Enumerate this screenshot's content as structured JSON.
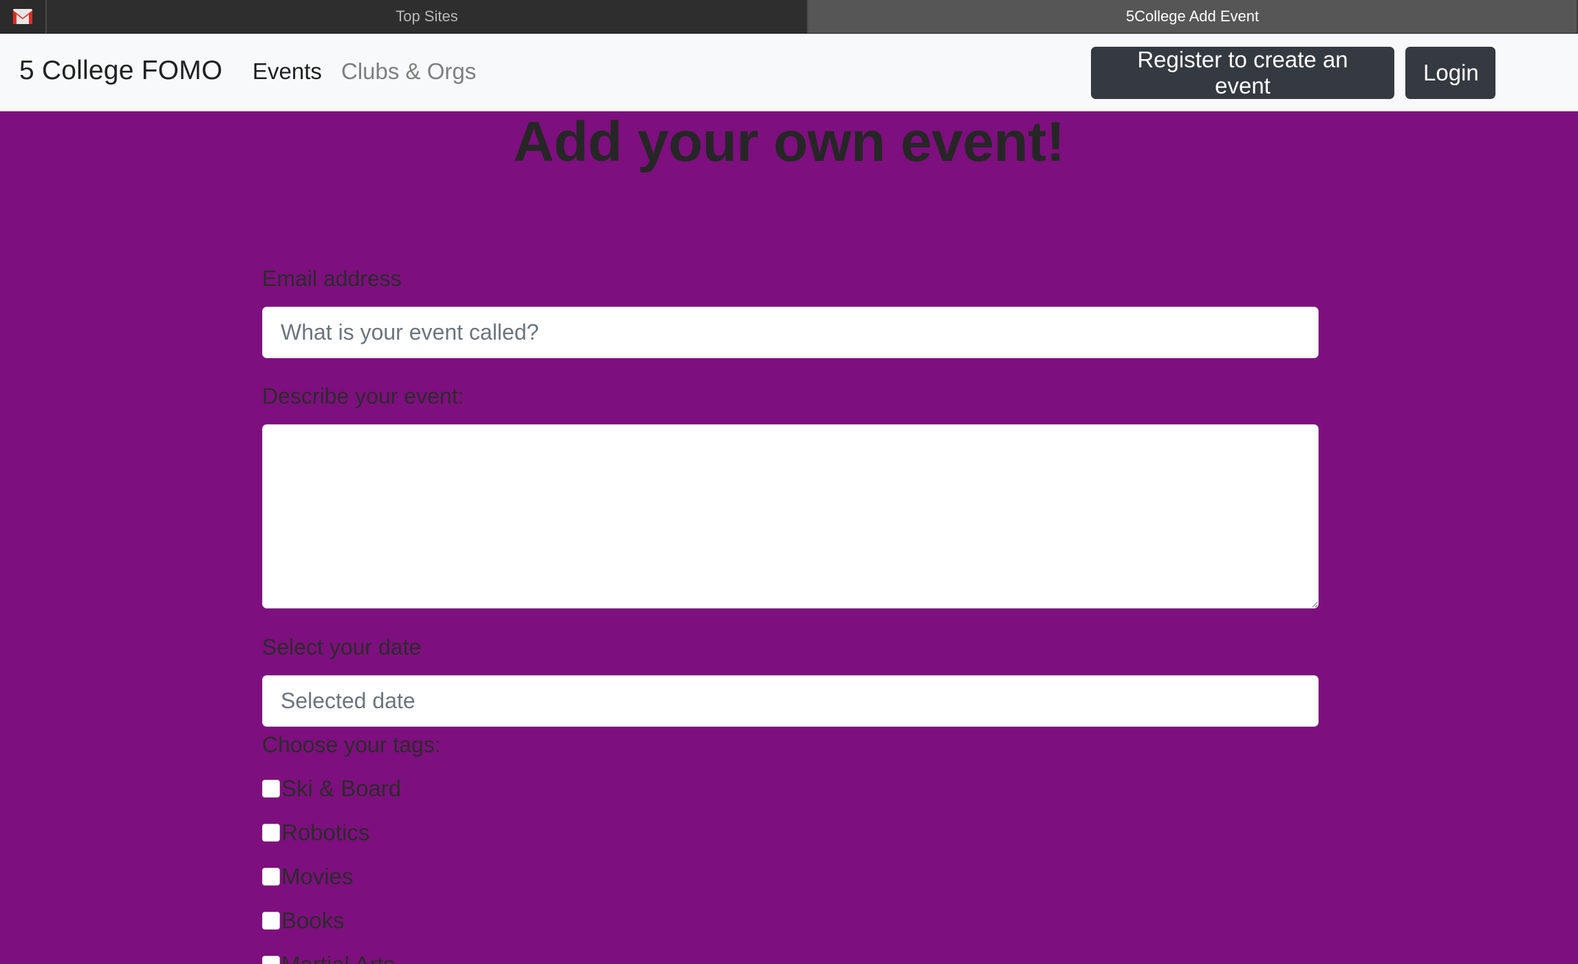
{
  "browser": {
    "pinned_tab_icon": "gmail-icon",
    "tabs": [
      {
        "label": "Top Sites",
        "active": false
      },
      {
        "label": "5College Add Event",
        "active": true
      }
    ]
  },
  "navbar": {
    "brand": "5 College FOMO",
    "links": [
      {
        "label": "Events",
        "active": true
      },
      {
        "label": "Clubs & Orgs",
        "active": false
      }
    ],
    "register_button": "Register to create an event",
    "login_button": "Login"
  },
  "form": {
    "title": "Add your own event!",
    "email": {
      "label": "Email address",
      "placeholder": "What is your event called?",
      "value": ""
    },
    "description": {
      "label": "Describe your event:",
      "value": ""
    },
    "date": {
      "label": "Select your date",
      "placeholder": "Selected date",
      "value": ""
    },
    "tags": {
      "label": "Choose your tags:",
      "options": [
        {
          "label": "Ski & Board",
          "checked": false
        },
        {
          "label": "Robotics",
          "checked": false
        },
        {
          "label": "Movies",
          "checked": false
        },
        {
          "label": "Books",
          "checked": false
        },
        {
          "label": "Martial Arts",
          "checked": false
        }
      ]
    }
  },
  "colors": {
    "page_background": "#7e0f7e",
    "navbar_background": "#f8f9fa",
    "button_dark": "#343a40",
    "tabstrip_background": "#2b2b2b"
  }
}
